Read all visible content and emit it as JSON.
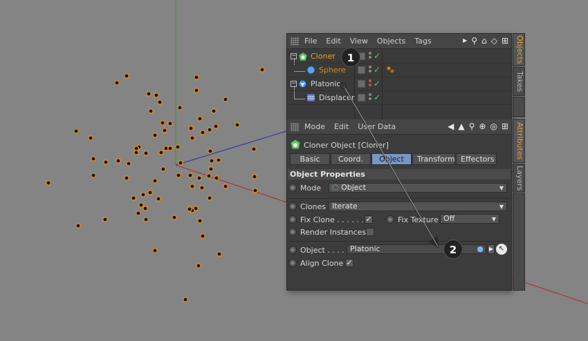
{
  "objects_panel": {
    "menu": [
      "File",
      "Edit",
      "View",
      "Objects",
      "Tags"
    ],
    "tree": [
      {
        "name": "Cloner",
        "color": "#f0a11f",
        "icon": "cloner-icon"
      },
      {
        "name": "Sphere",
        "color": "#d98a20",
        "icon": "sphere-icon"
      },
      {
        "name": "Platonic",
        "color": "#d8d8d8",
        "icon": "platonic-icon"
      },
      {
        "name": "Displacer",
        "color": "#d8d8d8",
        "icon": "displacer-icon"
      }
    ]
  },
  "attributes_panel": {
    "menu": [
      "Mode",
      "Edit",
      "User Data"
    ],
    "title": "Cloner Object [Cloner]",
    "tabs": [
      "Basic",
      "Coord.",
      "Object",
      "Transform",
      "Effectors"
    ],
    "active_tab": "Object",
    "section": "Object Properties",
    "mode_label": "Mode",
    "mode_value": "Object",
    "clones_label": "Clones",
    "clones_value": "Iterate",
    "fix_clone_label": "Fix Clone . . . . . .",
    "fix_texture_label": "Fix Texture",
    "fix_texture_value": "Off",
    "render_instances_label": "Render Instances",
    "object_label": "Object . . . .",
    "object_value": "Platonic",
    "align_clone_label": "Align Clone"
  },
  "side_tabs": {
    "objects": "Objects",
    "takes": "Takes",
    "attributes": "Attributes",
    "layers": "Layers"
  },
  "annotations": [
    "1",
    "2"
  ],
  "colors": {
    "accent_orange": "#f0a11f",
    "tab_active": "#7895c4",
    "check_green": "#4fcf5f",
    "viewport_bg": "#848484"
  }
}
